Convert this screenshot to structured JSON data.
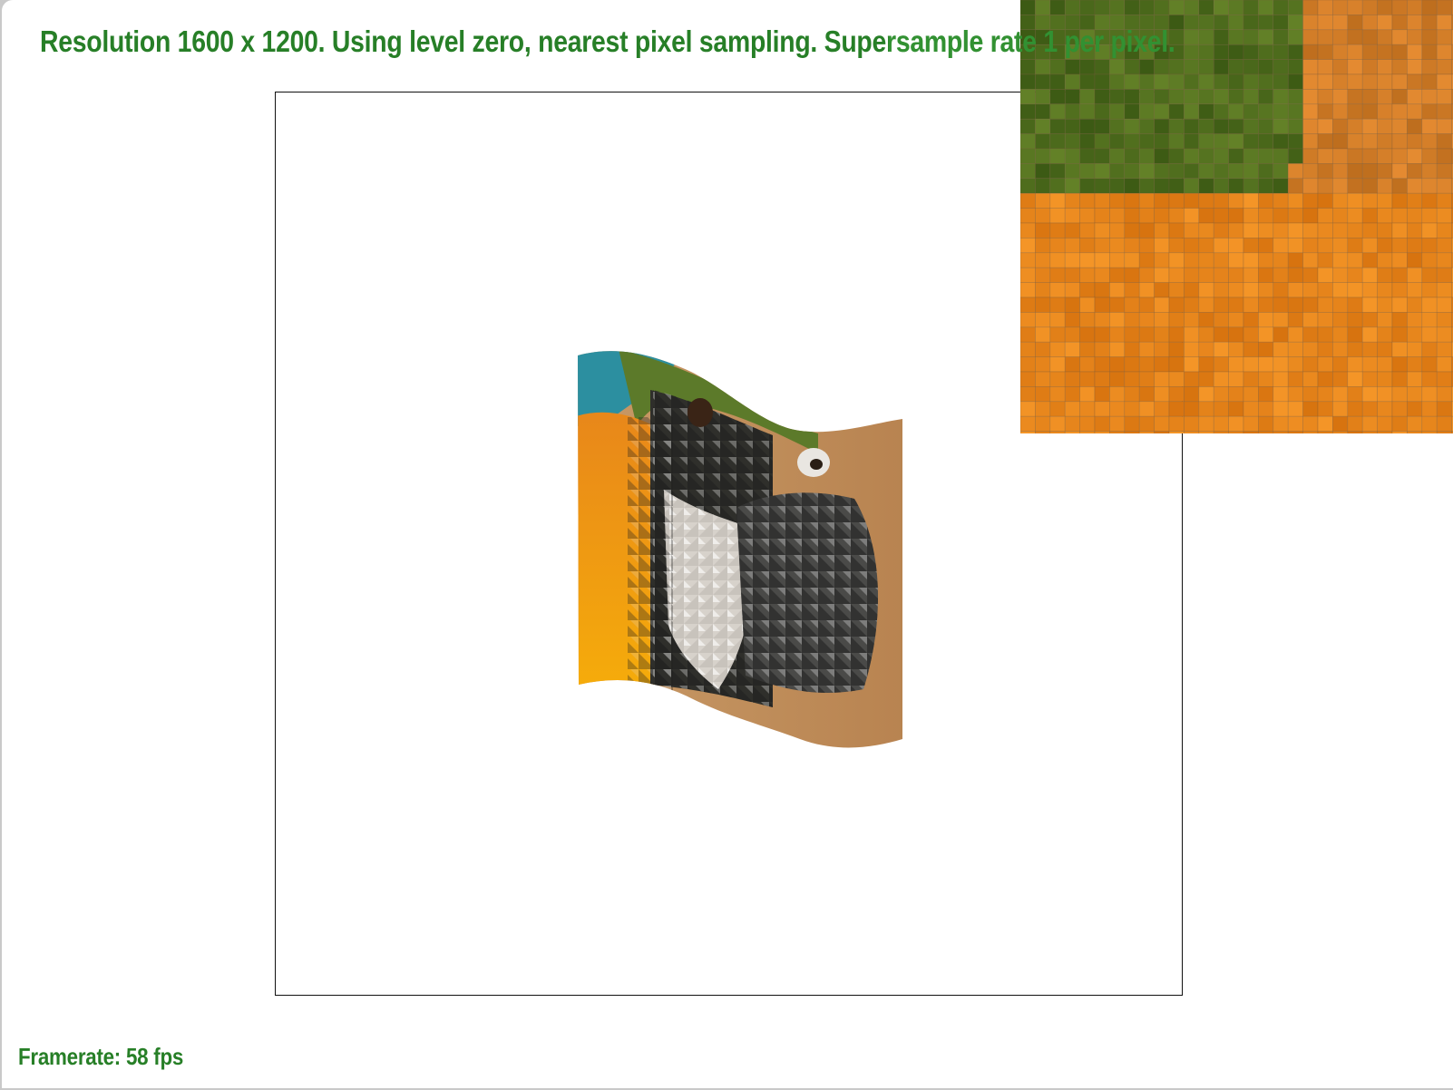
{
  "status": {
    "top_text": "Resolution 1600 x 1200. Using level zero, nearest pixel sampling. Supersample rate 1 per pixel.",
    "framerate_text": "Framerate: 58 fps"
  },
  "colors": {
    "status_text": "#277f27",
    "background": "#ffffff",
    "frame_border": "#111111"
  },
  "scene": {
    "subject": "macaw-texture",
    "zoom_inset": "pixel-grid-magnifier"
  }
}
